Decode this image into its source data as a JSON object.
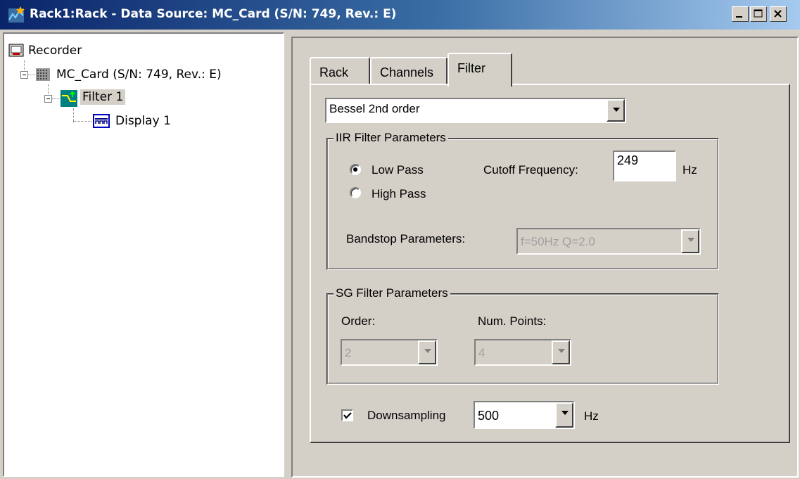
{
  "window": {
    "title": "Rack1:Rack - Data Source: MC_Card (S/N: 749, Rev.: E)",
    "icon": "rack-app-icon",
    "controls": [
      "minimize-icon",
      "maximize-icon",
      "close-icon"
    ]
  },
  "tree": {
    "nodes": [
      {
        "label": "Recorder",
        "icon": "recorder-icon"
      },
      {
        "label": "MC_Card (S/N: 749, Rev.: E)",
        "icon": "card-icon",
        "expanded": true
      },
      {
        "label": "Filter 1",
        "icon": "filter-icon",
        "expanded": true,
        "selected": true
      },
      {
        "label": "Display 1",
        "icon": "display-icon"
      }
    ]
  },
  "tabs": [
    {
      "label": "Rack",
      "active": false
    },
    {
      "label": "Channels",
      "active": false
    },
    {
      "label": "Filter",
      "active": true
    }
  ],
  "filter": {
    "type_value": "Bessel 2nd order",
    "iir": {
      "title": "IIR Filter Parameters",
      "low_pass_label": "Low Pass",
      "high_pass_label": "High Pass",
      "selected": "Low Pass",
      "cutoff_label": "Cutoff Frequency:",
      "cutoff_value": "249",
      "cutoff_unit": "Hz",
      "bandstop_label": "Bandstop Parameters:",
      "bandstop_value": "f=50Hz Q=2.0"
    },
    "sg": {
      "title": "SG Filter Parameters",
      "order_label": "Order:",
      "order_value": "2",
      "points_label": "Num. Points:",
      "points_value": "4"
    },
    "downsampling": {
      "label": "Downsampling",
      "checked": true,
      "value": "500",
      "unit": "Hz"
    }
  },
  "colors": {
    "face": "#d4d0c8",
    "title_start": "#0a246a",
    "title_end": "#a6caf0",
    "selection": "#d4d0c8"
  }
}
